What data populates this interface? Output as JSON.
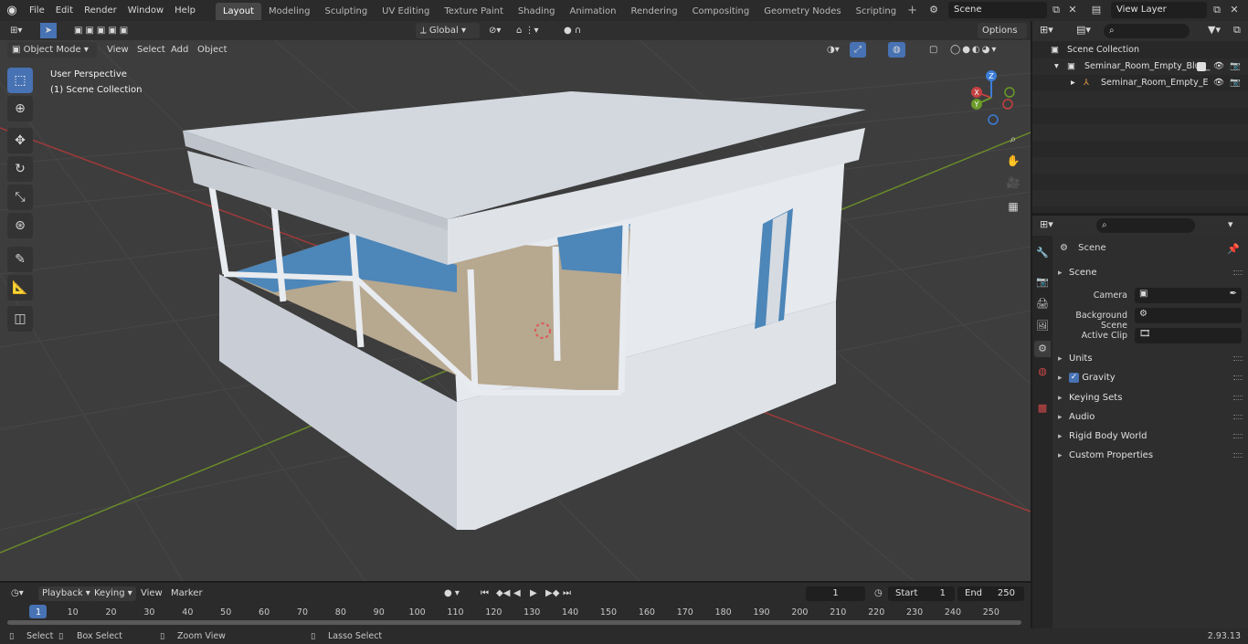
{
  "menubar": {
    "items": [
      "File",
      "Edit",
      "Render",
      "Window",
      "Help"
    ],
    "workspaces": [
      "Layout",
      "Modeling",
      "Sculpting",
      "UV Editing",
      "Texture Paint",
      "Shading",
      "Animation",
      "Rendering",
      "Compositing",
      "Geometry Nodes",
      "Scripting"
    ],
    "active_workspace": "Layout",
    "scene": "Scene",
    "view_layer": "View Layer"
  },
  "viewport": {
    "mode": "Object Mode",
    "menus": [
      "View",
      "Select",
      "Add",
      "Object"
    ],
    "orientation": "Global",
    "options": "Options",
    "perspective": "User Perspective",
    "collection": "(1) Scene Collection",
    "gizmo": {
      "x": "X",
      "y": "Y",
      "z": "Z"
    }
  },
  "outliner": {
    "root": "Scene Collection",
    "items": [
      "Seminar_Room_Empty_Blue_",
      "Seminar_Room_Empty_E"
    ]
  },
  "properties": {
    "context": "Scene",
    "section": "Scene",
    "fields": [
      "Camera",
      "Background Scene",
      "Active Clip"
    ],
    "panels": [
      "Units",
      "Gravity",
      "Keying Sets",
      "Audio",
      "Rigid Body World",
      "Custom Properties"
    ]
  },
  "timeline": {
    "menus": [
      "Playback",
      "Keying",
      "View",
      "Marker"
    ],
    "current_frame": "1",
    "start_label": "Start",
    "start": "1",
    "end_label": "End",
    "end": "250",
    "ticks": [
      "1",
      "10",
      "20",
      "30",
      "40",
      "50",
      "60",
      "70",
      "80",
      "90",
      "100",
      "110",
      "120",
      "130",
      "140",
      "150",
      "160",
      "170",
      "180",
      "190",
      "200",
      "210",
      "220",
      "230",
      "240",
      "250"
    ]
  },
  "statusbar": {
    "select": "Select",
    "box_select": "Box Select",
    "zoom_view": "Zoom View",
    "lasso_select": "Lasso Select",
    "version": "2.93.13"
  },
  "colors": {
    "accent": "#4772b3",
    "x_axis": "#c44040",
    "y_axis": "#6a9a2a",
    "z_axis": "#3b7dd8"
  }
}
